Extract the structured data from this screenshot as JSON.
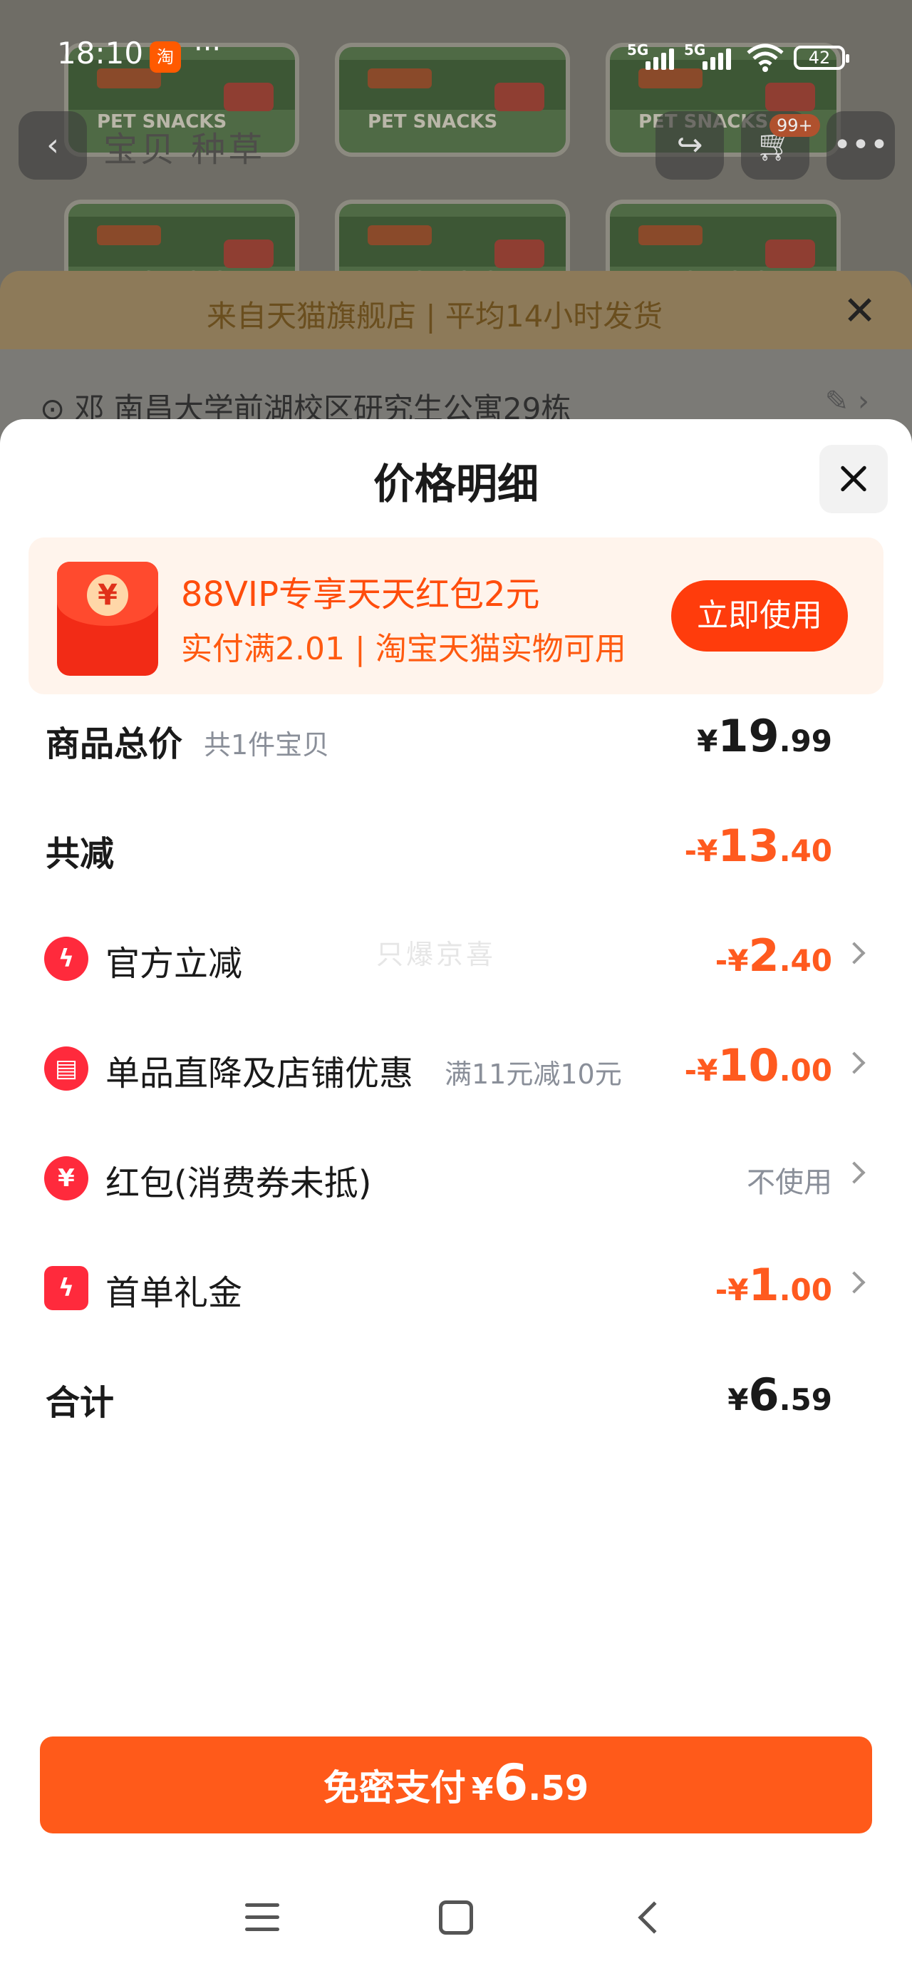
{
  "status_bar": {
    "time": "18:10",
    "app_badge": "淘",
    "more": "···",
    "network_1": "5G",
    "network_2": "5G",
    "battery": "42"
  },
  "background": {
    "product_text": "PET SNACKS",
    "nav_tabs": "宝贝  种草",
    "cart_badge": "99+",
    "shipping_notice": "来自天猫旗舰店 | 平均14小时发货",
    "address": "邓  南昌大学前湖校区研究生公寓29栋"
  },
  "sheet": {
    "title": "价格明细",
    "promo": {
      "icon_symbol": "¥",
      "title": "88VIP专享天天红包2元",
      "subtitle": "实付满2.01 | 淘宝天猫实物可用",
      "button": "立即使用"
    },
    "rows": {
      "total_goods": {
        "label": "商品总价",
        "note": "共1件宝贝",
        "sym": "¥",
        "int": "19",
        "dec": ".99"
      },
      "total_discount": {
        "label": "共减",
        "sym": "-¥",
        "int": "13",
        "dec": ".40"
      },
      "official": {
        "label": "官方立减",
        "sym": "-¥",
        "int": "2",
        "dec": ".40"
      },
      "store": {
        "label": "单品直降及店铺优惠",
        "note": "满11元减10元",
        "sym": "-¥",
        "int": "10",
        "dec": ".00"
      },
      "redpacket": {
        "label": "红包(消费券未抵)",
        "value": "不使用"
      },
      "first_order": {
        "label": "首单礼金",
        "sym": "-¥",
        "int": "1",
        "dec": ".00"
      },
      "sum": {
        "label": "合计",
        "sym": "¥",
        "int": "6",
        "dec": ".59"
      }
    },
    "watermark": "只爆京喜",
    "pay_button": {
      "label": "免密支付",
      "sym": "¥",
      "int": "6",
      "dec": ".59"
    }
  },
  "colors": {
    "accent_orange": "#ff5a1f",
    "promo_bg": "#fff4ec",
    "pay_button": "#ff5a1a",
    "icon_red": "#ff2a3c"
  }
}
